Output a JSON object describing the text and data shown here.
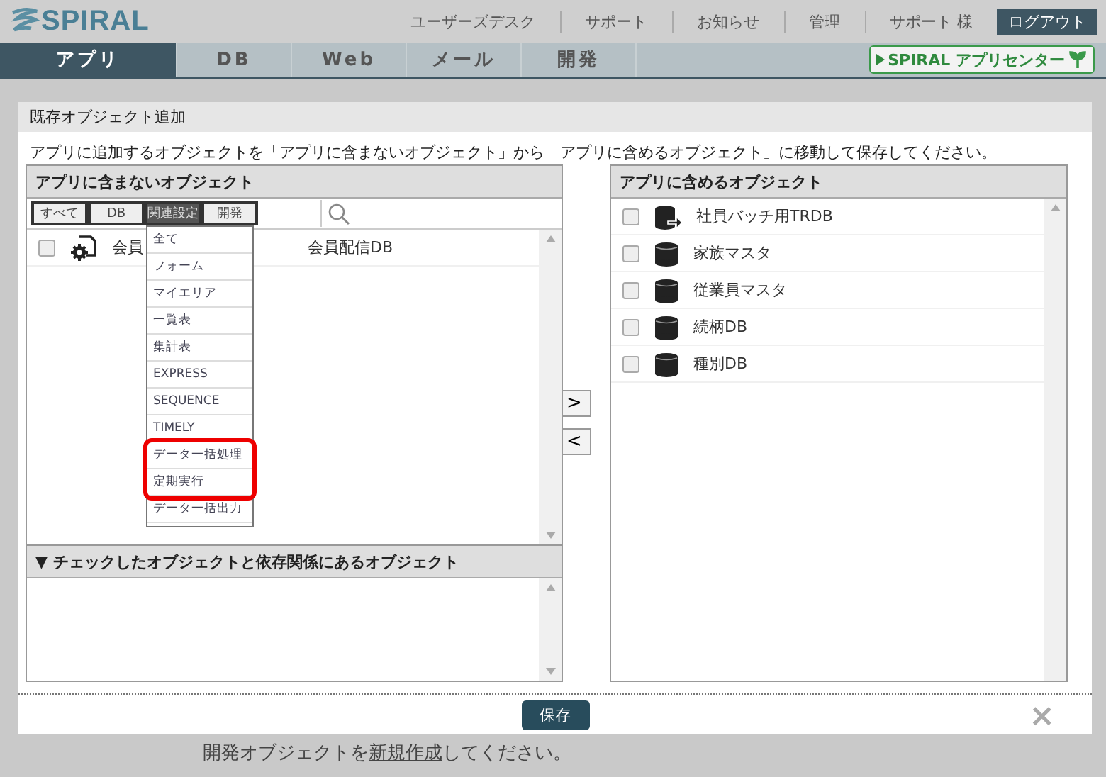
{
  "header": {
    "logo": "SPIRAL",
    "links": [
      "ユーザーズデスク",
      "サポート",
      "お知らせ",
      "管理",
      "サポート 様"
    ],
    "logout": "ログアウト"
  },
  "nav": {
    "tabs": [
      {
        "label": "アプリ",
        "selected": true
      },
      {
        "label": "DB",
        "selected": false
      },
      {
        "label": "Web",
        "selected": false
      },
      {
        "label": "メール",
        "selected": false
      },
      {
        "label": "開発",
        "selected": false
      }
    ],
    "app_center": "SPIRAL アプリセンター"
  },
  "background": {
    "message_start": "開発オブジェクトを",
    "message_link": "新規作成",
    "message_end": "してください。"
  },
  "dialog": {
    "title": "既存オブジェクト追加",
    "instruction": "アプリに追加するオブジェクトを「アプリに含まないオブジェクト」から「アプリに含めるオブジェクト」に移動して保存してください。",
    "excluded": {
      "title": "アプリに含まないオブジェクト",
      "filters": [
        {
          "label": "すべて",
          "selected": false
        },
        {
          "label": "DB",
          "selected": false
        },
        {
          "label": "関連設定",
          "selected": true
        },
        {
          "label": "開発",
          "selected": false
        }
      ],
      "rows": [
        {
          "checked": false,
          "kind": "gear-doc",
          "text_start": "会員",
          "text_end": "会員配信DB"
        }
      ],
      "menu": {
        "groups": [
          {
            "highlighted": false,
            "items": [
              "全て",
              "フォーム",
              "マイエリア",
              "一覧表",
              "集計表",
              "EXPRESS",
              "SEQUENCE",
              "TIMELY"
            ]
          },
          {
            "highlighted": true,
            "items": [
              "データ一括処理",
              "定期実行"
            ]
          },
          {
            "highlighted": false,
            "items": [
              "データ一括出力"
            ]
          }
        ]
      }
    },
    "dependencies": {
      "title": "▼ チェックしたオブジェクトと依存関係にあるオブジェクト"
    },
    "move_buttons": [
      ">",
      "<"
    ],
    "included": {
      "title": "アプリに含めるオブジェクト",
      "rows": [
        {
          "checked": false,
          "kind": "db-transfer",
          "text": "社員バッチ用TRDB"
        },
        {
          "checked": false,
          "kind": "db",
          "text": "家族マスタ"
        },
        {
          "checked": false,
          "kind": "db",
          "text": "従業員マスタ"
        },
        {
          "checked": false,
          "kind": "db",
          "text": "続柄DB"
        },
        {
          "checked": false,
          "kind": "db",
          "text": "種別DB"
        }
      ]
    },
    "save": "保存",
    "close": "×"
  }
}
